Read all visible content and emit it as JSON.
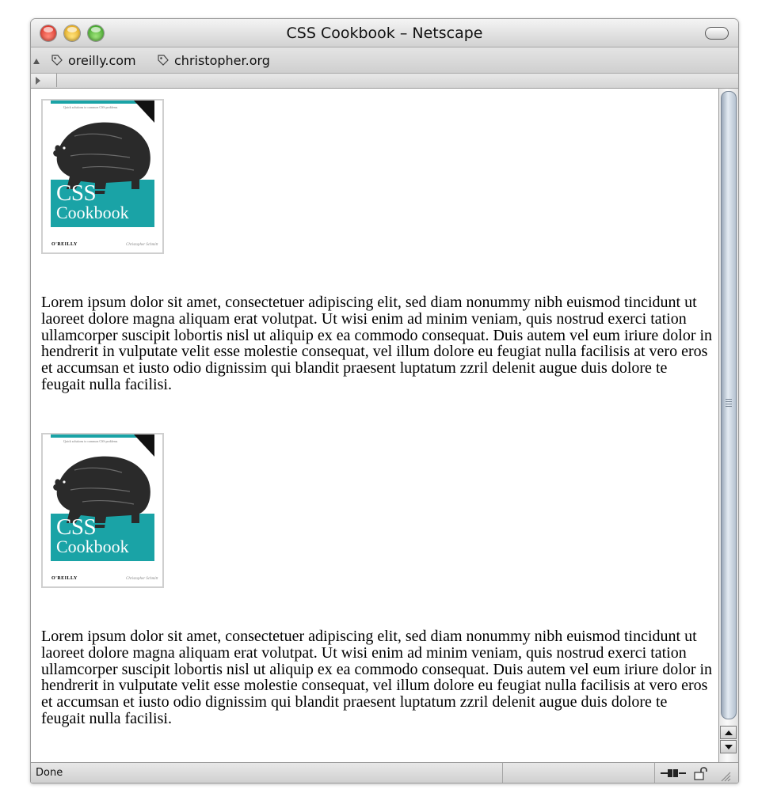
{
  "window": {
    "title": "CSS Cookbook – Netscape"
  },
  "bookmarks": [
    {
      "label": "oreilly.com",
      "icon": "bookmark-icon"
    },
    {
      "label": "christopher.org",
      "icon": "bookmark-icon"
    }
  ],
  "content": {
    "books": [
      {
        "cover_title": "CSS",
        "cover_subtitle": "Cookbook",
        "publisher": "O'REILLY",
        "author": "Christopher Schmitt",
        "tagline": "Quick solutions to common CSS problems"
      },
      {
        "cover_title": "CSS",
        "cover_subtitle": "Cookbook",
        "publisher": "O'REILLY",
        "author": "Christopher Schmitt",
        "tagline": "Quick solutions to common CSS problems"
      }
    ],
    "paragraphs": [
      "Lorem ipsum dolor sit amet, consectetuer adipiscing elit, sed diam nonummy nibh euismod tincidunt ut laoreet dolore magna aliquam erat volutpat. Ut wisi enim ad minim veniam, quis nostrud exerci tation ullamcorper suscipit lobortis nisl ut aliquip ex ea commodo consequat. Duis autem vel eum iriure dolor in hendrerit in vulputate velit esse molestie consequat, vel illum dolore eu feugiat nulla facilisis at vero eros et accumsan et iusto odio dignissim qui blandit praesent luptatum zzril delenit augue duis dolore te feugait nulla facilisi.",
      "Lorem ipsum dolor sit amet, consectetuer adipiscing elit, sed diam nonummy nibh euismod tincidunt ut laoreet dolore magna aliquam erat volutpat. Ut wisi enim ad minim veniam, quis nostrud exerci tation ullamcorper suscipit lobortis nisl ut aliquip ex ea commodo consequat. Duis autem vel eum iriure dolor in hendrerit in vulputate velit esse molestie consequat, vel illum dolore eu feugiat nulla facilisis at vero eros et accumsan et iusto odio dignissim qui blandit praesent luptatum zzril delenit augue duis dolore te feugait nulla facilisi."
    ]
  },
  "status": {
    "text": "Done",
    "icons": [
      "online-icon",
      "lock-icon",
      "resize-grip-icon"
    ]
  },
  "colors": {
    "cover_teal": "#1aa3a6",
    "scroll_thumb": "#b5c2d0"
  }
}
